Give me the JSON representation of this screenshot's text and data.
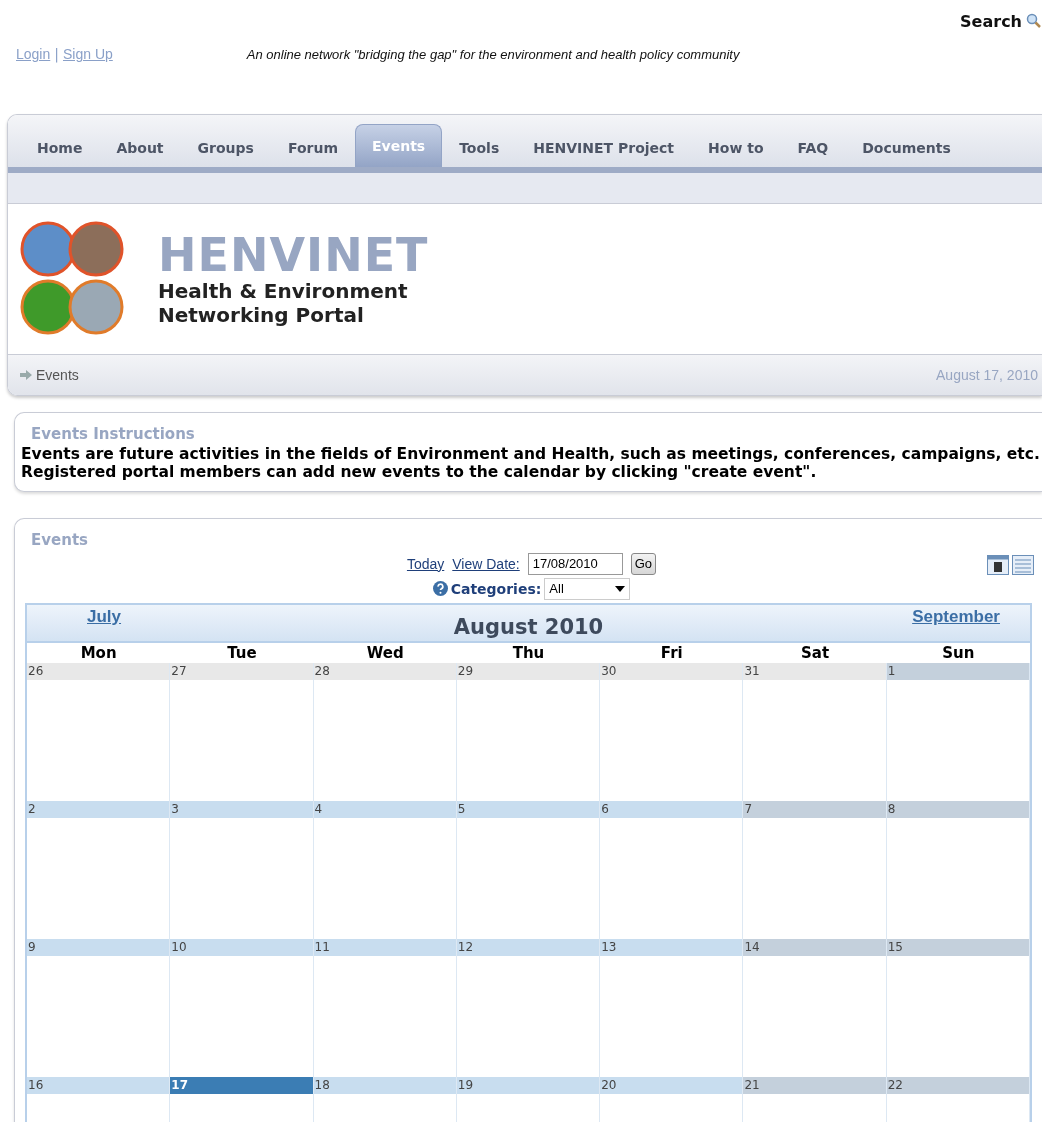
{
  "search": {
    "label": "Search"
  },
  "account_links": [
    "Login",
    "Sign Up"
  ],
  "account_separator": "|",
  "tagline": "An online network \"bridging the gap\" for the environment and health policy community",
  "nav": [
    {
      "label": "Home",
      "selected": false
    },
    {
      "label": "About",
      "selected": false
    },
    {
      "label": "Groups",
      "selected": false
    },
    {
      "label": "Forum",
      "selected": false
    },
    {
      "label": "Events",
      "selected": true
    },
    {
      "label": "Tools",
      "selected": false
    },
    {
      "label": "HENVINET Project",
      "selected": false
    },
    {
      "label": "How to",
      "selected": false
    },
    {
      "label": "FAQ",
      "selected": false
    },
    {
      "label": "Documents",
      "selected": false
    }
  ],
  "brand": {
    "name": "HENVINET",
    "subtitle_lines": [
      "Health & Environment",
      "Networking Portal"
    ]
  },
  "breadcrumb": {
    "label": "Events",
    "date": "August 17, 2010"
  },
  "instructions": {
    "title": "Events Instructions",
    "text": "Events are future activities in the fields of Environment and Health, such as meetings, conferences, campaigns, etc.  Registered portal members can add new events to the calendar by clicking \"create event\"."
  },
  "events": {
    "title": "Events",
    "today_link": "Today",
    "view_date_label": "View Date:",
    "view_date_value": "17/08/2010",
    "go_button": "Go",
    "categories_label": "Categories:",
    "categories_value": "All",
    "calendar": {
      "prev": "July",
      "month": "August 2010",
      "next": "September",
      "weekdays": [
        "Mon",
        "Tue",
        "Wed",
        "Thu",
        "Fri",
        "Sat",
        "Sun"
      ],
      "weeks": [
        [
          {
            "label": "26",
            "kind": "other",
            "selected": false
          },
          {
            "label": "27",
            "kind": "other",
            "selected": false
          },
          {
            "label": "28",
            "kind": "other",
            "selected": false
          },
          {
            "label": "29",
            "kind": "other",
            "selected": false
          },
          {
            "label": "30",
            "kind": "other",
            "selected": false
          },
          {
            "label": "31",
            "kind": "other",
            "selected": false
          },
          {
            "label": "1",
            "kind": "weekend",
            "selected": false
          }
        ],
        [
          {
            "label": "2",
            "kind": "current",
            "selected": false
          },
          {
            "label": "3",
            "kind": "current",
            "selected": false
          },
          {
            "label": "4",
            "kind": "current",
            "selected": false
          },
          {
            "label": "5",
            "kind": "current",
            "selected": false
          },
          {
            "label": "6",
            "kind": "current",
            "selected": false
          },
          {
            "label": "7",
            "kind": "weekend",
            "selected": false
          },
          {
            "label": "8",
            "kind": "weekend",
            "selected": false
          }
        ],
        [
          {
            "label": "9",
            "kind": "current",
            "selected": false
          },
          {
            "label": "10",
            "kind": "current",
            "selected": false
          },
          {
            "label": "11",
            "kind": "current",
            "selected": false
          },
          {
            "label": "12",
            "kind": "current",
            "selected": false
          },
          {
            "label": "13",
            "kind": "current",
            "selected": false
          },
          {
            "label": "14",
            "kind": "weekend",
            "selected": false
          },
          {
            "label": "15",
            "kind": "weekend",
            "selected": false
          }
        ],
        [
          {
            "label": "16",
            "kind": "current",
            "selected": false
          },
          {
            "label": "17",
            "kind": "current",
            "selected": true
          },
          {
            "label": "18",
            "kind": "current",
            "selected": false
          },
          {
            "label": "19",
            "kind": "current",
            "selected": false
          },
          {
            "label": "20",
            "kind": "current",
            "selected": false
          },
          {
            "label": "21",
            "kind": "weekend",
            "selected": false
          },
          {
            "label": "22",
            "kind": "weekend",
            "selected": false
          }
        ]
      ]
    }
  }
}
